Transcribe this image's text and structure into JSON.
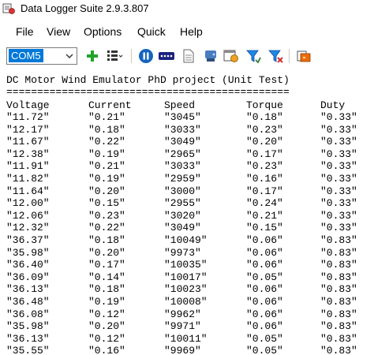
{
  "window": {
    "title": "Data Logger Suite 2.9.3.807"
  },
  "menu": [
    "File",
    "View",
    "Options",
    "Quick",
    "Help"
  ],
  "toolbar": {
    "port_value": "COM5",
    "icons": [
      "add-icon",
      "list-icon",
      "pause-icon",
      "port-icon",
      "file-icon",
      "drive-icon",
      "calendar-icon",
      "filter-icon",
      "filter-remove-icon",
      "export-icon"
    ]
  },
  "log": {
    "title_line": "DC Motor Wind Emulator PhD project (Unit Test)",
    "separator": "==============================================",
    "columns": [
      "Voltage",
      "Current",
      "Speed",
      "Torque",
      "Duty"
    ],
    "rows": [
      [
        "\"11.72\"",
        "\"0.21\"",
        "\"3045\"",
        "\"0.18\"",
        "\"0.33\""
      ],
      [
        "\"12.17\"",
        "\"0.18\"",
        "\"3033\"",
        "\"0.23\"",
        "\"0.33\""
      ],
      [
        "\"11.67\"",
        "\"0.22\"",
        "\"3049\"",
        "\"0.20\"",
        "\"0.33\""
      ],
      [
        "\"12.38\"",
        "\"0.19\"",
        "\"2965\"",
        "\"0.17\"",
        "\"0.33\""
      ],
      [
        "\"11.91\"",
        "\"0.21\"",
        "\"3033\"",
        "\"0.23\"",
        "\"0.33\""
      ],
      [
        "\"11.82\"",
        "\"0.19\"",
        "\"2959\"",
        "\"0.16\"",
        "\"0.33\""
      ],
      [
        "\"11.64\"",
        "\"0.20\"",
        "\"3000\"",
        "\"0.17\"",
        "\"0.33\""
      ],
      [
        "\"12.00\"",
        "\"0.15\"",
        "\"2955\"",
        "\"0.24\"",
        "\"0.33\""
      ],
      [
        "\"12.06\"",
        "\"0.23\"",
        "\"3020\"",
        "\"0.21\"",
        "\"0.33\""
      ],
      [
        "\"12.32\"",
        "\"0.22\"",
        "\"3049\"",
        "\"0.15\"",
        "\"0.33\""
      ],
      [
        "\"36.37\"",
        "\"0.18\"",
        "\"10049\"",
        "\"0.06\"",
        "\"0.83\""
      ],
      [
        "\"35.98\"",
        "\"0.20\"",
        "\"9973\"",
        "\"0.06\"",
        "\"0.83\""
      ],
      [
        "\"36.40\"",
        "\"0.17\"",
        "\"10035\"",
        "\"0.06\"",
        "\"0.83\""
      ],
      [
        "\"36.09\"",
        "\"0.14\"",
        "\"10017\"",
        "\"0.05\"",
        "\"0.83\""
      ],
      [
        "\"36.13\"",
        "\"0.18\"",
        "\"10023\"",
        "\"0.06\"",
        "\"0.83\""
      ],
      [
        "\"36.48\"",
        "\"0.19\"",
        "\"10008\"",
        "\"0.06\"",
        "\"0.83\""
      ],
      [
        "\"36.08\"",
        "\"0.12\"",
        "\"9962\"",
        "\"0.06\"",
        "\"0.83\""
      ],
      [
        "\"35.98\"",
        "\"0.20\"",
        "\"9971\"",
        "\"0.06\"",
        "\"0.83\""
      ],
      [
        "\"36.13\"",
        "\"0.12\"",
        "\"10011\"",
        "\"0.05\"",
        "\"0.83\""
      ],
      [
        "\"35.55\"",
        "\"0.16\"",
        "\"9969\"",
        "\"0.05\"",
        "\"0.83\""
      ]
    ]
  }
}
